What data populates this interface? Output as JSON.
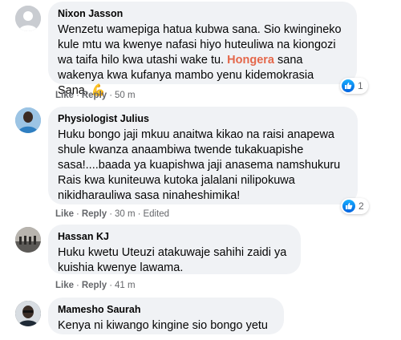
{
  "comments": [
    {
      "author": "Nixon Jasson",
      "text_before": "Wenzetu wamepiga hatua kubwa sana. Sio kwingineko kule mtu wa kwenye nafasi hiyo huteuliwa na kiongozi wa taifa hilo kwa utashi wake tu. ",
      "highlight": "Hongera",
      "text_after": " sana wakenya kwa kufanya mambo yenu kidemokrasia Sana. ",
      "emoji": "💪",
      "like_label": "Like",
      "reply_label": "Reply",
      "time": "50 m",
      "reaction_count": "1"
    },
    {
      "author": "Physiologist Julius",
      "text": "Huku bongo jaji mkuu anaitwa kikao na raisi anapewa shule kwanza anaambiwa twende tukakuapishe sasa!....baada ya kuapishwa jaji anasema namshukuru Rais kwa kuniteuwa kutoka jalalani nilipokuwa nikidharauliwa sasa ninaheshimika!",
      "like_label": "Like",
      "reply_label": "Reply",
      "time": "30 m",
      "edited": "Edited",
      "reaction_count": "2"
    },
    {
      "author": "Hassan KJ",
      "text": "Huku kwetu Uteuzi atakuwaje sahihi zaidi ya kuishia kwenye lawama.",
      "like_label": "Like",
      "reply_label": "Reply",
      "time": "41 m"
    },
    {
      "author": "Mamesho Saurah",
      "text": "Kenya ni kiwango kingine sio bongo yetu"
    }
  ],
  "dot": "·",
  "colors": {
    "bubble_bg": "#f0f2f5",
    "highlight": "#e4674a",
    "meta": "#65676b",
    "like_blue": "#1877f2"
  }
}
